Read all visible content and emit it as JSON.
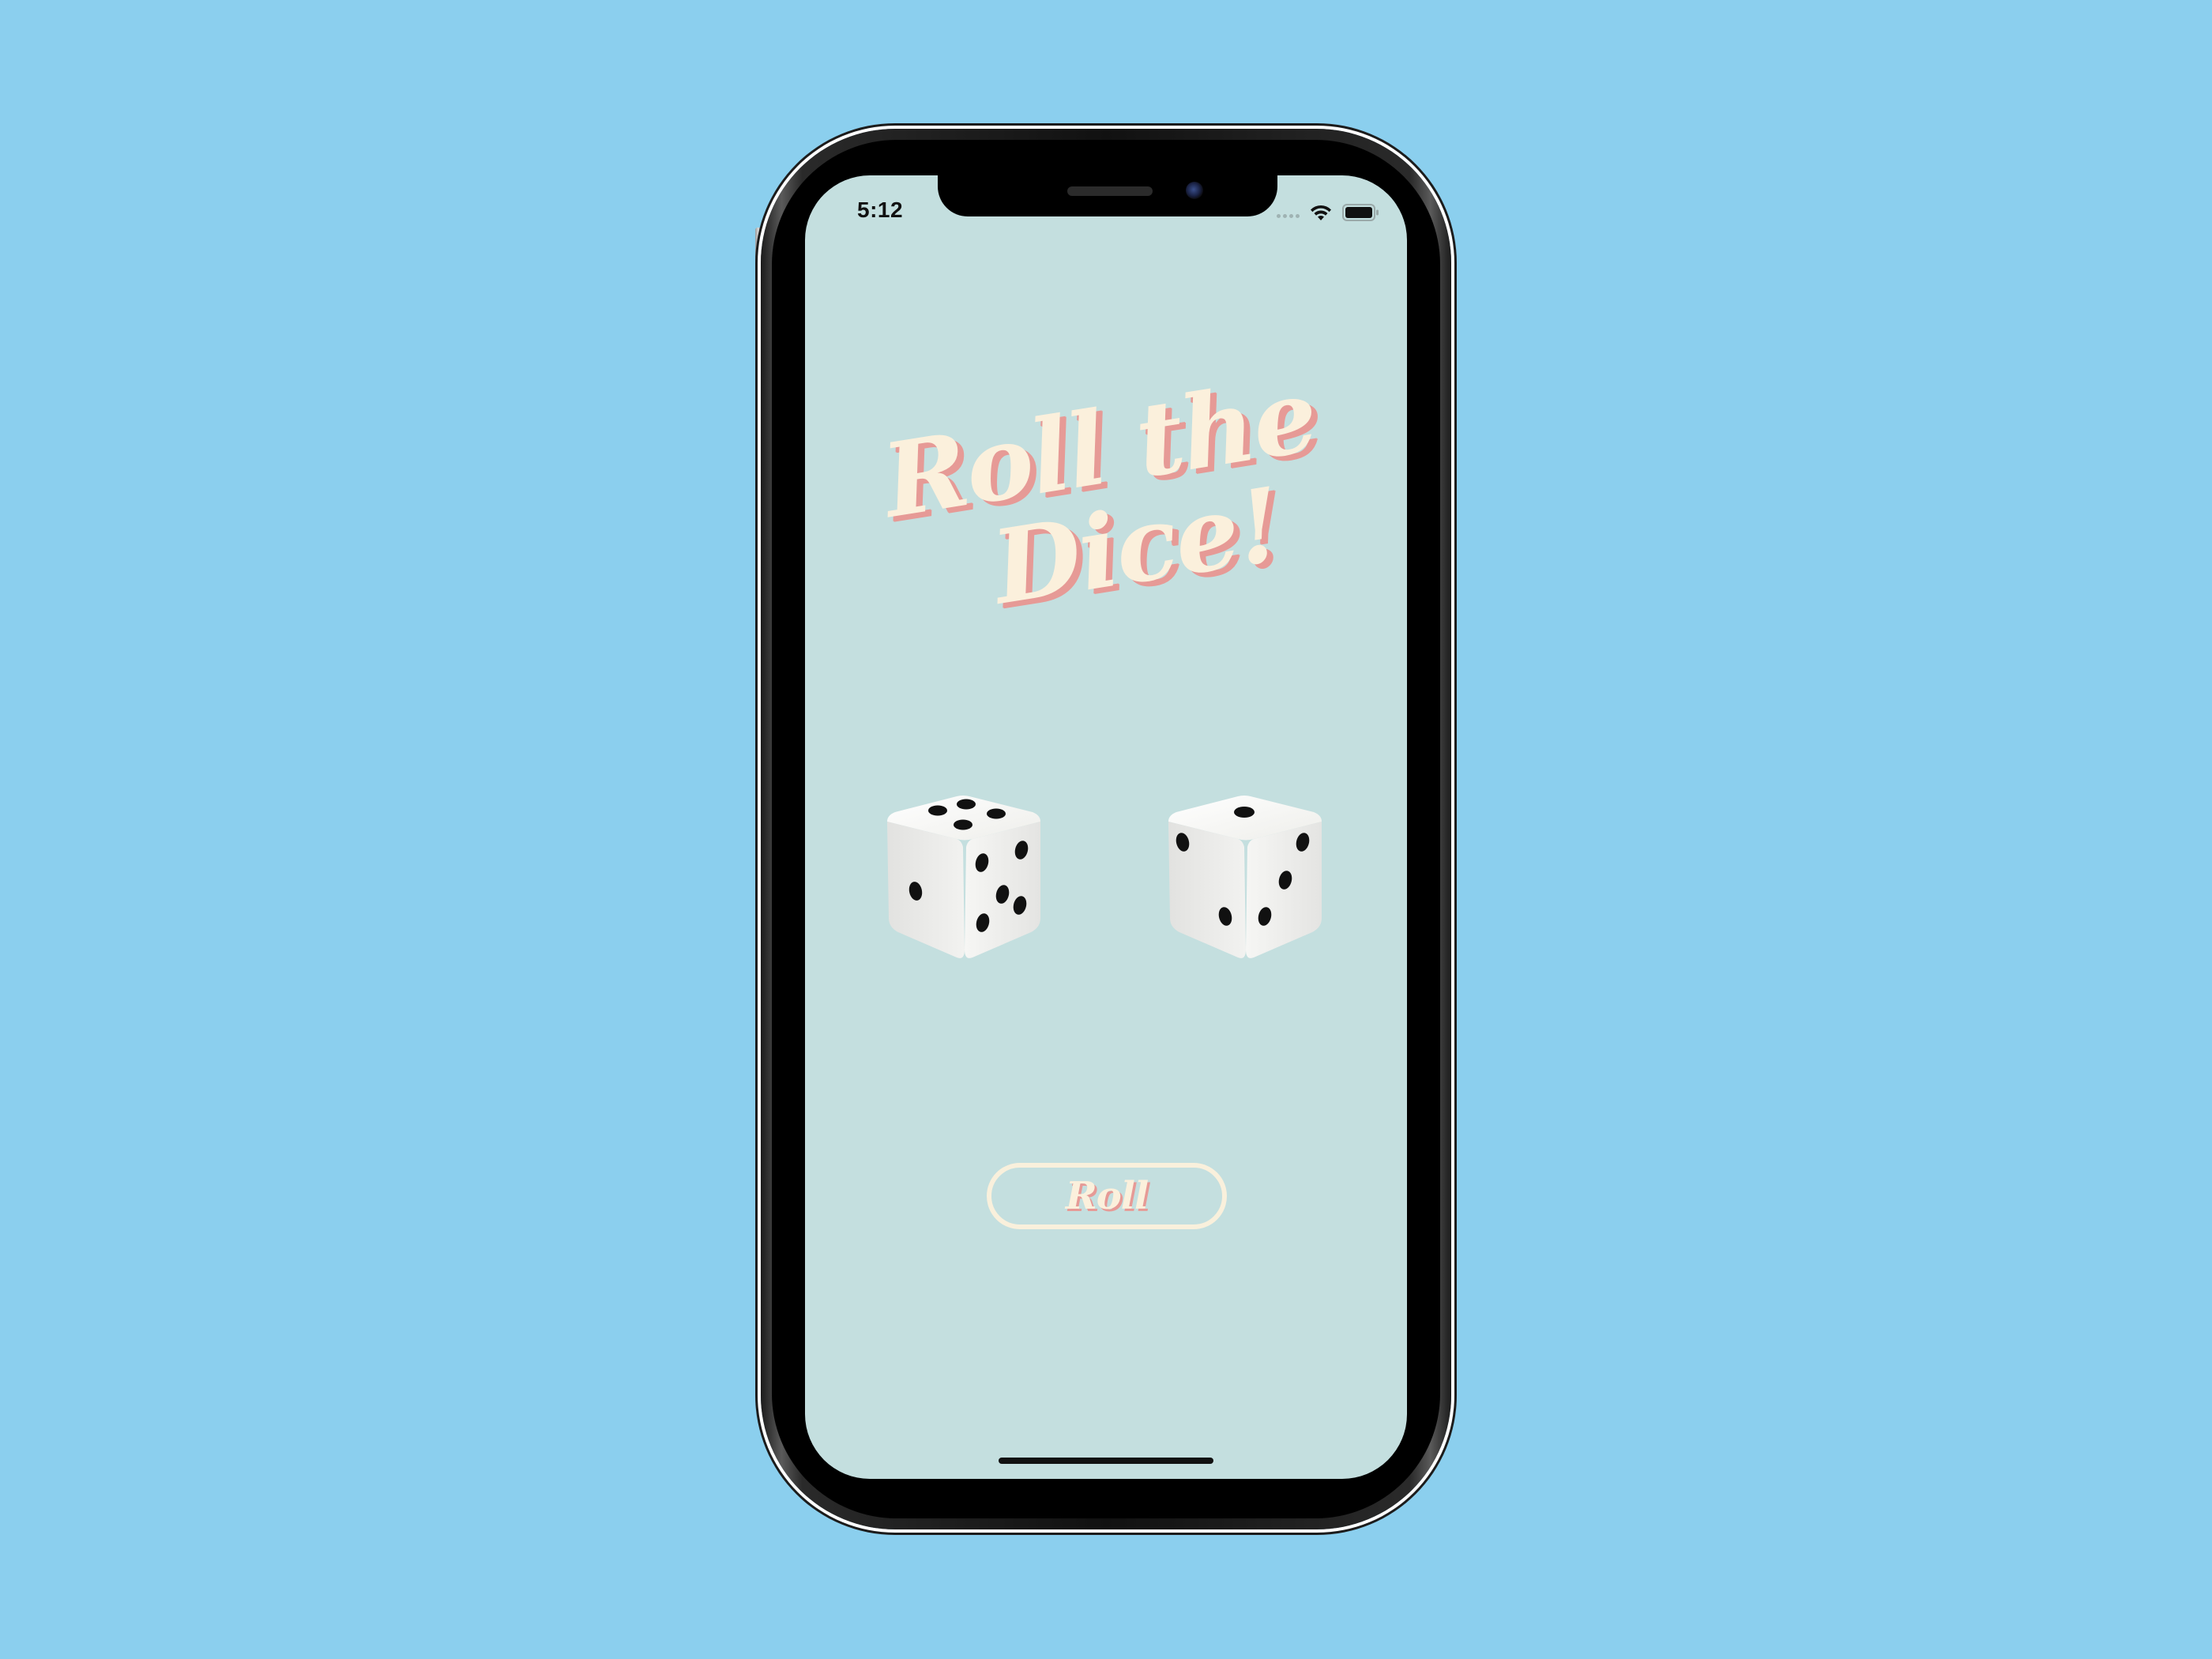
{
  "status_bar": {
    "time": "5:12",
    "icons": [
      "signal-dots-icon",
      "wifi-icon",
      "battery-icon"
    ]
  },
  "app": {
    "title_line_1": "Roll the",
    "title_line_2": "Dice!",
    "dice": [
      {
        "name": "left-die",
        "top_face": 4,
        "front_face": 5,
        "side_face": 1
      },
      {
        "name": "right-die",
        "top_face": 1,
        "front_face": 3,
        "side_face": 2
      }
    ],
    "roll_button_label": "Roll"
  },
  "colors": {
    "page_background": "#8bcfee",
    "screen_background": "#c4dfdf",
    "title_text": "#fbf0dc",
    "title_shadow": "#e69a96",
    "button_border": "#f9f0dc"
  }
}
